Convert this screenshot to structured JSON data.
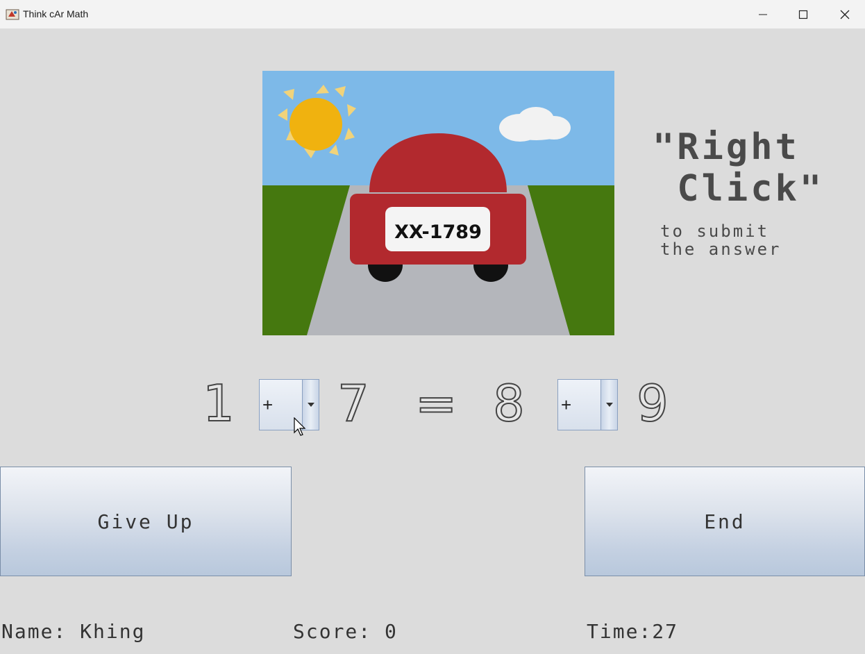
{
  "window": {
    "title": "Think cAr Math"
  },
  "scene": {
    "plate_text": "XX-1789",
    "colors": {
      "sky": "#7db9e8",
      "grass": "#45780f",
      "road": "#b4b6bb",
      "car": "#b2292e",
      "sun": "#f0b20f",
      "sun_rays": "#f1d37a",
      "cloud": "#f2f2f2",
      "plate": "#f4f4f4",
      "wheels": "#111111"
    }
  },
  "hint": {
    "big": "\"Right\n Click\"",
    "small": "to submit\nthe answer"
  },
  "equation": {
    "d1": "1",
    "op1": "+",
    "d2": "7",
    "eq": "=",
    "d3": "8",
    "op2": "+",
    "d4": "9"
  },
  "buttons": {
    "give_up": "Give Up",
    "end": "End"
  },
  "status": {
    "name": "Name: Khing",
    "score": "Score: 0",
    "time": "Time:27"
  }
}
